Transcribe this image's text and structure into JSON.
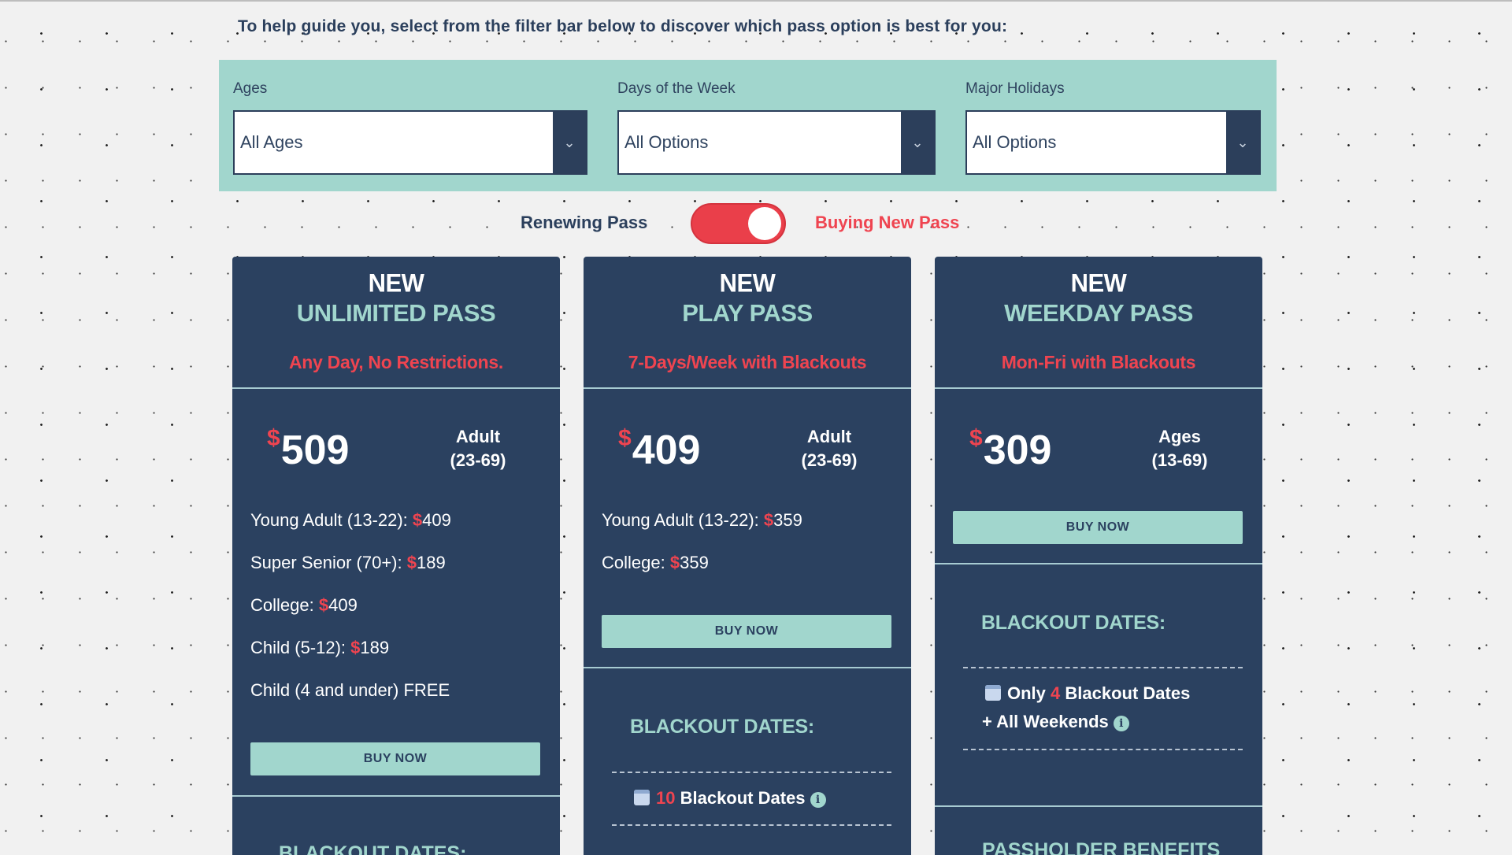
{
  "intro": "To help guide you, select from the filter bar below to discover which pass option is best for you:",
  "filters": [
    {
      "label": "Ages",
      "value": "All Ages"
    },
    {
      "label": "Days of the Week",
      "value": "All Options"
    },
    {
      "label": "Major Holidays",
      "value": "All Options"
    }
  ],
  "toggle": {
    "left_label": "Renewing Pass",
    "right_label": "Buying New Pass",
    "state": "Buying New Pass"
  },
  "currency": "$",
  "cards": [
    {
      "new": "NEW",
      "name": "UNLIMITED PASS",
      "tagline": "Any Day, No Restrictions.",
      "price": "509",
      "price_label_1": "Adult",
      "price_label_2": "(23-69)",
      "tiers": [
        {
          "label": "Young Adult (13-22): ",
          "price": "409"
        },
        {
          "label": "Super Senior (70+): ",
          "price": "189"
        },
        {
          "label": "College: ",
          "price": "409"
        },
        {
          "label": "Child (5-12): ",
          "price": "189"
        },
        {
          "label": "Child (4 and under) FREE",
          "price": ""
        }
      ],
      "buy": "BUY NOW",
      "cut_heading": "BLACKOUT DATES:"
    },
    {
      "new": "NEW",
      "name": "PLAY PASS",
      "tagline": "7-Days/Week with Blackouts",
      "price": "409",
      "price_label_1": "Adult",
      "price_label_2": "(23-69)",
      "tiers": [
        {
          "label": "Young Adult (13-22): ",
          "price": "359"
        },
        {
          "label": "College: ",
          "price": "359"
        }
      ],
      "buy": "BUY NOW",
      "blackout_heading": "BLACKOUT DATES:",
      "blackout_num": "10",
      "blackout_text": " Blackout Dates"
    },
    {
      "new": "NEW",
      "name": "WEEKDAY PASS",
      "tagline": "Mon-Fri with Blackouts",
      "price": "309",
      "price_label_1": "Ages",
      "price_label_2": "(13-69)",
      "buy": "BUY NOW",
      "blackout_heading": "BLACKOUT DATES:",
      "blackout_pre": "Only ",
      "blackout_num": "4",
      "blackout_text": " Blackout Dates",
      "blackout_line2": "+ All Weekends",
      "cut_heading": "PASSHOLDER BENEFITS"
    }
  ],
  "colors": {
    "navy": "#2b4160",
    "mint": "#a1d6cd",
    "red": "#ef4450"
  }
}
